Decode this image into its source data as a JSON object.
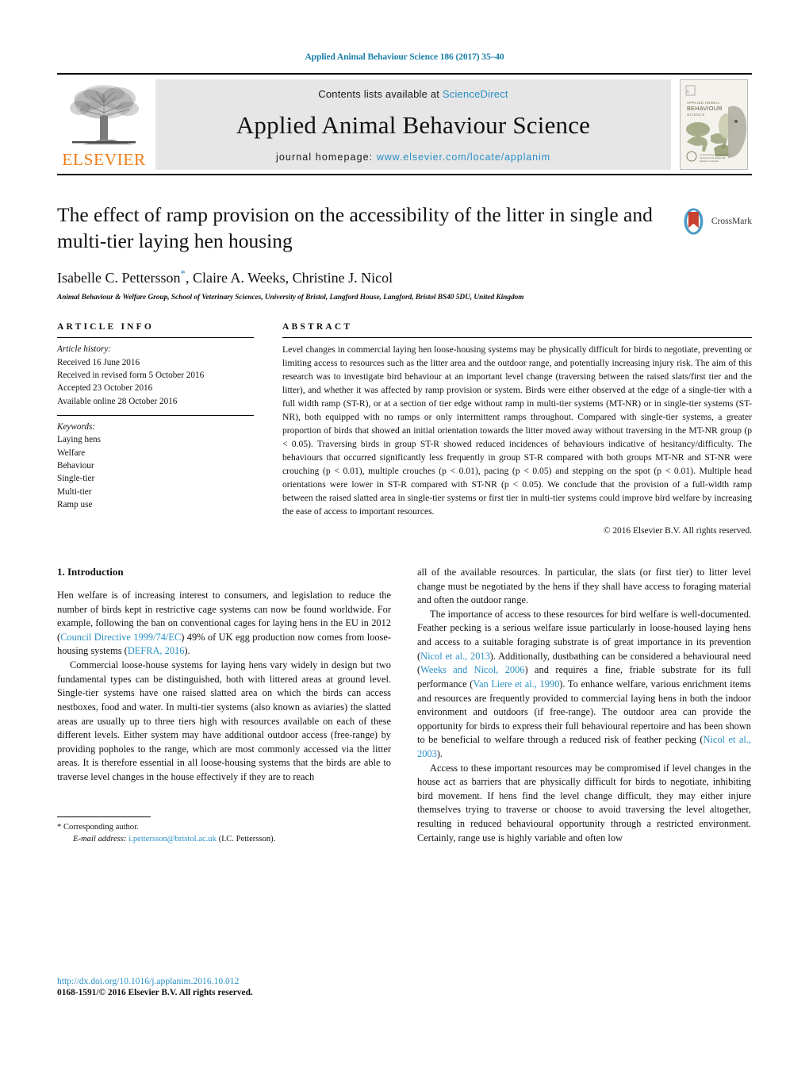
{
  "running_head": "Applied Animal Behaviour Science 186 (2017) 35–40",
  "masthead": {
    "contents_prefix": "Contents lists available at ",
    "sciencedirect": "ScienceDirect",
    "journal_title": "Applied Animal Behaviour Science",
    "homepage_label": "journal homepage:",
    "homepage_url": "www.elsevier.com/locate/applanim",
    "publisher_word": "ELSEVIER",
    "cover_caption": "APPLIED ANIMAL BEHAVIOUR SCIENCE",
    "link_color": "#2a8fc4",
    "elsevier_orange": "#ef7d1a",
    "band_color": "#e6e6e6"
  },
  "article": {
    "title": "The effect of ramp provision on the accessibility of the litter in single and multi-tier laying hen housing",
    "authors": "Isabelle C. Pettersson",
    "authors_rest": ", Claire A. Weeks, Christine J. Nicol",
    "corresponding_marker": "*",
    "affiliation": "Animal Behaviour & Welfare Group, School of Veterinary Sciences, University of Bristol, Langford House, Langford, Bristol BS40 5DU, United Kingdom",
    "crossmark_label": "CrossMark"
  },
  "article_info": {
    "heading": "ARTICLE INFO",
    "history_label": "Article history:",
    "history": [
      "Received 16 June 2016",
      "Received in revised form 5 October 2016",
      "Accepted 23 October 2016",
      "Available online 28 October 2016"
    ],
    "keywords_label": "Keywords:",
    "keywords": [
      "Laying hens",
      "Welfare",
      "Behaviour",
      "Single-tier",
      "Multi-tier",
      "Ramp use"
    ]
  },
  "abstract": {
    "heading": "ABSTRACT",
    "text": "Level changes in commercial laying hen loose-housing systems may be physically difficult for birds to negotiate, preventing or limiting access to resources such as the litter area and the outdoor range, and potentially increasing injury risk. The aim of this research was to investigate bird behaviour at an important level change (traversing between the raised slats/first tier and the litter), and whether it was affected by ramp provision or system. Birds were either observed at the edge of a single-tier with a full width ramp (ST-R), or at a section of tier edge without ramp in multi-tier systems (MT-NR) or in single-tier systems (ST-NR), both equipped with no ramps or only intermittent ramps throughout. Compared with single-tier systems, a greater proportion of birds that showed an initial orientation towards the litter moved away without traversing in the MT-NR group (p < 0.05). Traversing birds in group ST-R showed reduced incidences of behaviours indicative of hesitancy/difficulty. The behaviours that occurred significantly less frequently in group ST-R compared with both groups MT-NR and ST-NR were crouching (p < 0.01), multiple crouches (p < 0.01), pacing (p < 0.05) and stepping on the spot (p < 0.01). Multiple head orientations were lower in ST-R compared with ST-NR (p < 0.05). We conclude that the provision of a full-width ramp between the raised slatted area in single-tier systems or first tier in multi-tier systems could improve bird welfare by increasing the ease of access to important resources.",
    "copyright": "© 2016 Elsevier B.V. All rights reserved."
  },
  "introduction": {
    "heading": "1.  Introduction",
    "left_paragraphs": [
      "Hen welfare is of increasing interest to consumers, and legislation to reduce the number of birds kept in restrictive cage systems can now be found worldwide. For example, following the ban on conventional cages for laying hens in the EU in 2012 (Council Directive 1999/74/EC) 49% of UK egg production now comes from loose-housing systems (DEFRA, 2016).",
      "Commercial loose-house systems for laying hens vary widely in design but two fundamental types can be distinguished, both with littered areas at ground level. Single-tier systems have one raised slatted area on which the birds can access nestboxes, food and water. In multi-tier systems (also known as aviaries) the slatted areas are usually up to three tiers high with resources available on each of these different levels. Either system may have additional outdoor access (free-range) by providing popholes to the range, which are most commonly accessed via the litter areas. It is therefore essential in all loose-housing systems that the birds are able to traverse level changes in the house effectively if they are to reach"
    ],
    "right_paragraphs": [
      "all of the available resources. In particular, the slats (or first tier) to litter level change must be negotiated by the hens if they shall have access to foraging material and often the outdoor range.",
      "The importance of access to these resources for bird welfare is well-documented. Feather pecking is a serious welfare issue particularly in loose-housed laying hens and access to a suitable foraging substrate is of great importance in its prevention (Nicol et al., 2013). Additionally, dustbathing can be considered a behavioural need (Weeks and Nicol, 2006) and requires a fine, friable substrate for its full performance (Van Liere et al., 1990). To enhance welfare, various enrichment items and resources are frequently provided to commercial laying hens in both the indoor environment and outdoors (if free-range). The outdoor area can provide the opportunity for birds to express their full behavioural repertoire and has been shown to be beneficial to welfare through a reduced risk of feather pecking (Nicol et al., 2003).",
      "Access to these important resources may be compromised if level changes in the house act as barriers that are physically difficult for birds to negotiate, inhibiting bird movement. If hens find the level change difficult, they may either injure themselves trying to traverse or choose to avoid traversing the level altogether, resulting in reduced behavioural opportunity through a restricted environment. Certainly, range use is highly variable and often low"
    ],
    "references_inline": [
      "Council Directive 1999/74/EC",
      "DEFRA, 2016",
      "Nicol et al., 2013",
      "Weeks and Nicol, 2006",
      "Van Liere et al., 1990",
      "Nicol et al., 2003"
    ]
  },
  "footer": {
    "corresponding_marker": "*",
    "corresponding_label": "Corresponding author.",
    "email_label": "E-mail address:",
    "email": "i.pettersson@bristol.ac.uk",
    "email_owner": "(I.C. Pettersson).",
    "doi": "http://dx.doi.org/10.1016/j.applanim.2016.10.012",
    "issn_line": "0168-1591/© 2016 Elsevier B.V. All rights reserved."
  }
}
